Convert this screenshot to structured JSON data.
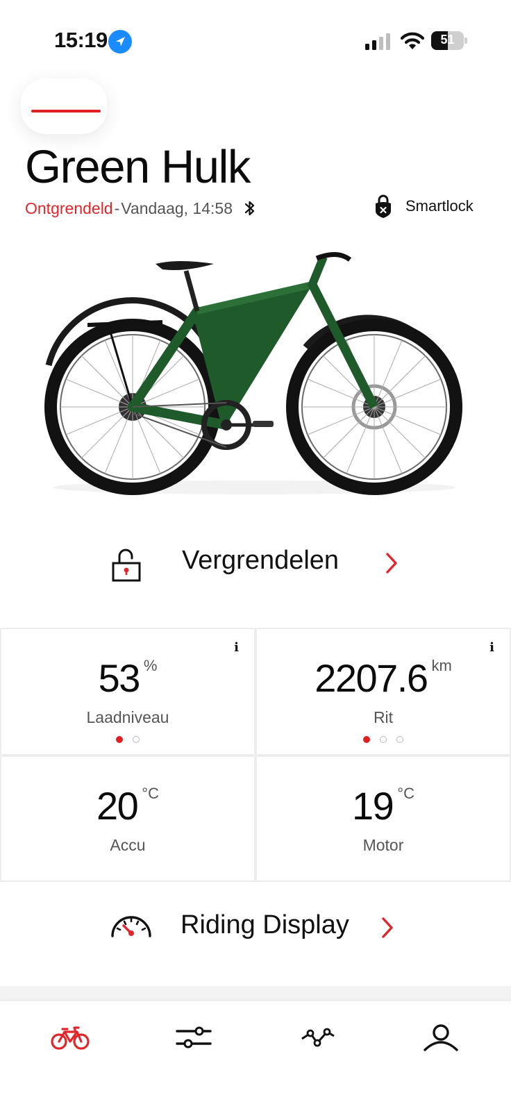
{
  "status_bar": {
    "time": "15:19",
    "battery_percent": "51",
    "battery_level": 0.51,
    "location_icon": "location-arrow-icon",
    "signal_icon": "cellular-signal-icon",
    "wifi_icon": "wifi-icon"
  },
  "header": {
    "menu_icon": "menu-icon",
    "bike_name": "Green Hulk",
    "lock_state": "Ontgrendeld",
    "separator": "-",
    "last_seen": "Vandaag, 14:58",
    "bluetooth_icon": "bluetooth-icon",
    "smartlock_label": "Smartlock",
    "smartlock_icon": "smartlock-icon"
  },
  "bike_image": "green-ebike-image",
  "lock_action": {
    "label": "Vergrendelen",
    "icon": "padlock-open-icon"
  },
  "stats": [
    {
      "value": "53",
      "unit": "%",
      "label": "Laadniveau",
      "has_info": true,
      "info_label": "i",
      "page_count": 2,
      "active_page": 0
    },
    {
      "value": "2207.6",
      "unit": "km",
      "label": "Rit",
      "has_info": true,
      "info_label": "i",
      "page_count": 3,
      "active_page": 0
    },
    {
      "value": "20",
      "unit": "°C",
      "label": "Accu",
      "has_info": false
    },
    {
      "value": "19",
      "unit": "°C",
      "label": "Motor",
      "has_info": false
    }
  ],
  "riding_display": {
    "label": "Riding Display",
    "icon": "speedometer-icon"
  },
  "bottom_nav": [
    {
      "icon": "bike-icon",
      "active": true
    },
    {
      "icon": "sliders-icon",
      "active": false
    },
    {
      "icon": "route-icon",
      "active": false
    },
    {
      "icon": "profile-icon",
      "active": false
    }
  ],
  "colors": {
    "accent": "#e0262b",
    "text": "#111111",
    "muted": "#555555",
    "bike_green": "#1f5a2a",
    "ios_blue": "#1a8cff"
  }
}
